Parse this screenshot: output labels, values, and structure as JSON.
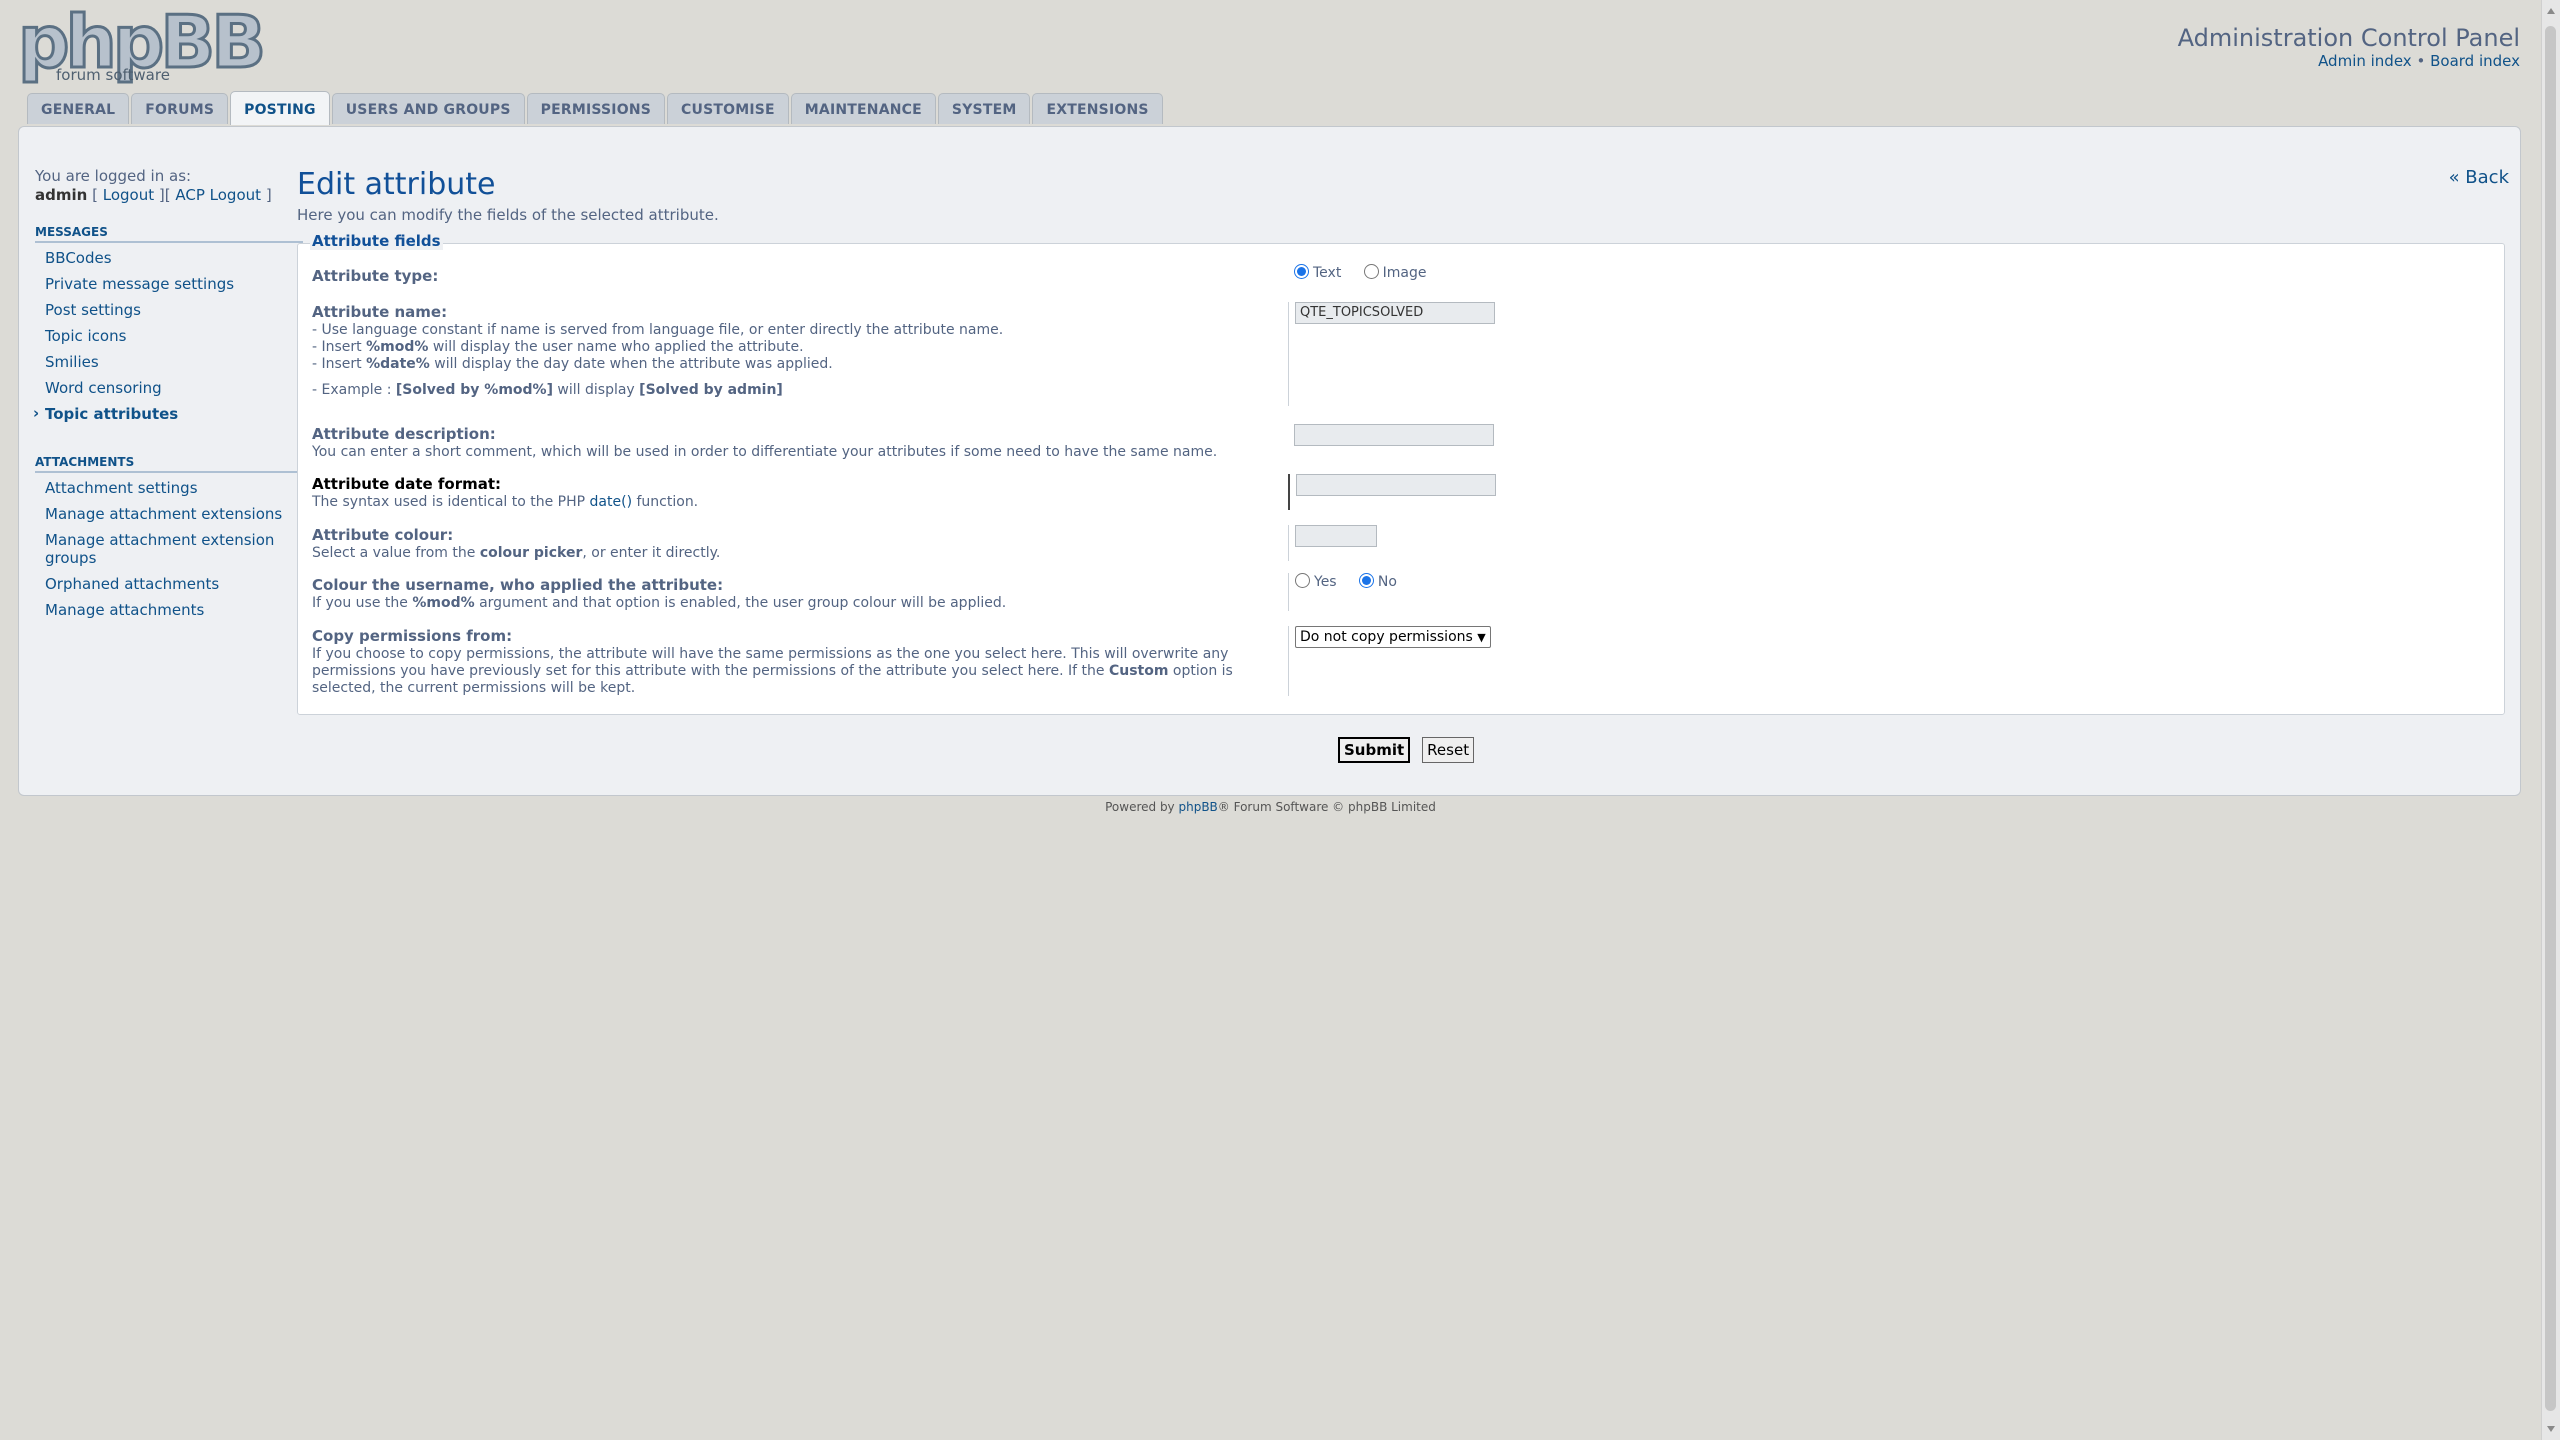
{
  "header": {
    "logo_text": "phpBB",
    "logo_sub": "forum  software",
    "title": "Administration Control Panel",
    "admin_index": "Admin index",
    "separator": "•",
    "board_index": "Board index"
  },
  "tabs": [
    {
      "label": "GENERAL"
    },
    {
      "label": "FORUMS"
    },
    {
      "label": "POSTING",
      "active": true
    },
    {
      "label": "USERS AND GROUPS"
    },
    {
      "label": "PERMISSIONS"
    },
    {
      "label": "CUSTOMISE"
    },
    {
      "label": "MAINTENANCE"
    },
    {
      "label": "SYSTEM"
    },
    {
      "label": "EXTENSIONS"
    }
  ],
  "sidebar": {
    "logged_in_as": "You are logged in as:",
    "username": "admin",
    "logout": "Logout",
    "acp_logout": "ACP Logout",
    "bracket_open": "[",
    "bracket_mid": "][",
    "bracket_close": "]",
    "sections": [
      {
        "title": "MESSAGES",
        "items": [
          "BBCodes",
          "Private message settings",
          "Post settings",
          "Topic icons",
          "Smilies",
          "Word censoring",
          "Topic attributes"
        ]
      },
      {
        "title": "ATTACHMENTS",
        "items": [
          "Attachment settings",
          "Manage attachment extensions",
          "Manage attachment extension groups",
          "Orphaned attachments",
          "Manage attachments"
        ]
      }
    ]
  },
  "content": {
    "title": "Edit attribute",
    "subtitle": "Here you can modify the fields of the selected attribute.",
    "back": "« Back",
    "fieldset_legend": "Attribute fields",
    "type": {
      "label": "Attribute type:",
      "opt_text": "Text",
      "opt_image": "Image",
      "selected": "Text"
    },
    "name": {
      "label": "Attribute name:",
      "line1": "- Use language constant if name is served from language file, or enter directly the attribute name.",
      "line2_pre": "- Insert ",
      "line2_code": "%mod%",
      "line2_post": " will display the user name who applied the attribute.",
      "line3_pre": "- Insert ",
      "line3_code": "%date%",
      "line3_post": " will display the day date when the attribute was applied.",
      "ex_pre": "- Example : ",
      "ex_code1": "[Solved by %mod%]",
      "ex_mid": " will display ",
      "ex_code2": "[Solved by admin]",
      "value": "QTE_TOPICSOLVED"
    },
    "description": {
      "label": "Attribute description:",
      "help": "You can enter a short comment, which will be used in order to differentiate your attributes if some need to have the same name.",
      "value": ""
    },
    "date_format": {
      "label": "Attribute date format:",
      "help_pre": "The syntax used is identical to the PHP ",
      "help_link": "date()",
      "help_post": " function.",
      "value": ""
    },
    "colour": {
      "label": "Attribute colour:",
      "help_pre": "Select a value from the ",
      "help_bold": "colour picker",
      "help_post": ", or enter it directly.",
      "value": ""
    },
    "user_colour": {
      "label": "Colour the username, who applied the attribute:",
      "help_pre": "If you use the ",
      "help_code": "%mod%",
      "help_post": " argument and that option is enabled, the user group colour will be applied.",
      "opt_yes": "Yes",
      "opt_no": "No",
      "selected": "No"
    },
    "copy_perms": {
      "label": "Copy permissions from:",
      "help1": "If you choose to copy permissions, the attribute will have the same permissions as the one you select here. This will overwrite any",
      "help2_pre": "permissions you have previously set for this attribute with the permissions of the attribute you select here. If the ",
      "help2_bold": "Custom",
      "help2_post": " option is",
      "help3": "selected, the current permissions will be kept.",
      "selected": "Do not copy permissions"
    },
    "submit": "Submit",
    "reset": "Reset"
  },
  "footer": {
    "pre": "Powered by ",
    "link": "phpBB",
    "post": "® Forum Software © phpBB Limited"
  },
  "colors": {
    "page_bg": "#dcdbd6",
    "link": "#105289",
    "title": "#115098",
    "text": "#536482"
  }
}
